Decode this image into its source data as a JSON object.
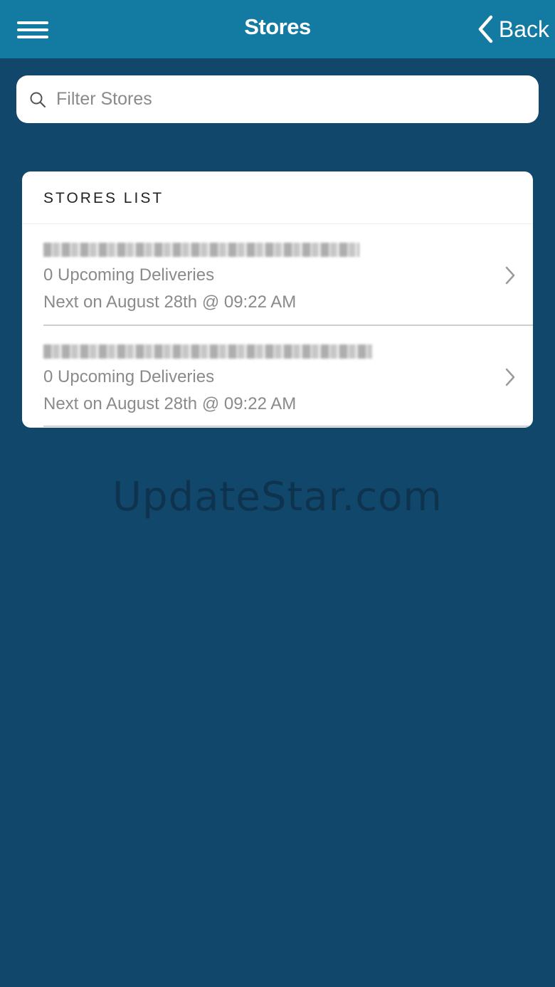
{
  "header": {
    "title": "Stores",
    "back_label": "Back"
  },
  "search": {
    "placeholder": "Filter Stores"
  },
  "stores_list": {
    "heading": "STORES LIST",
    "items": [
      {
        "upcoming": "0 Upcoming Deliveries",
        "next": "Next on August 28th @ 09:22 AM"
      },
      {
        "upcoming": "0 Upcoming Deliveries",
        "next": "Next on August 28th @ 09:22 AM"
      }
    ]
  },
  "watermark": "UpdateStar.com",
  "colors": {
    "header_bg": "#137aa1",
    "page_bg": "#12476c",
    "card_bg": "#ffffff",
    "secondary_text": "#8a8a8a"
  }
}
